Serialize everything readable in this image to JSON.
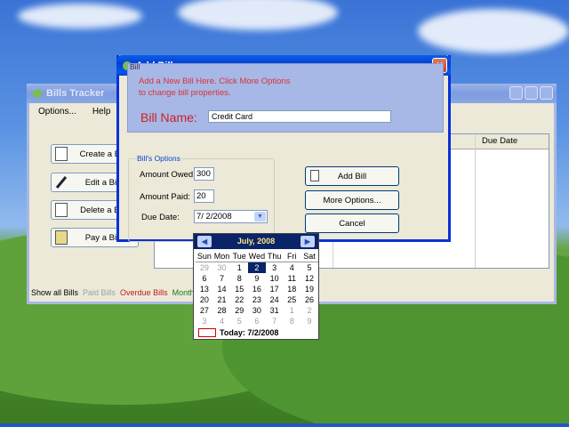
{
  "main_window": {
    "title": "Bills Tracker",
    "menu": [
      "Options...",
      "Help"
    ],
    "side_buttons": [
      "Create a Bill",
      "Edit a Bill",
      "Delete a Bill",
      "Pay a Bill"
    ],
    "grid_header_due": "Due Date",
    "status_tabs": [
      {
        "label": "Show all Bills",
        "color": "#000000"
      },
      {
        "label": "Paid Bills",
        "color": "#9aa0a6"
      },
      {
        "label": "Overdue Bills",
        "color": "#c21a1a"
      },
      {
        "label": "Monthly B",
        "color": "#1a7a1a"
      }
    ]
  },
  "dialog": {
    "title": "Add Bill",
    "bill_group_title": "Bill",
    "description_line1": "Add a New Bill Here. Click More Options",
    "description_line2": "to change bill properties.",
    "bill_name_label": "Bill Name:",
    "bill_name_value": "Credit Card",
    "options_group_title": "Bill's Options",
    "amount_owed_label": "Amount Owed:",
    "amount_owed_value": "300",
    "amount_paid_label": "Amount Paid:",
    "amount_paid_value": "20",
    "due_date_label": "Due Date:",
    "due_date_value": "7/  2/2008",
    "buttons": {
      "add": "Add Bill",
      "more": "More Options...",
      "cancel": "Cancel"
    }
  },
  "calendar": {
    "month_title": "July, 2008",
    "days_of_week": [
      "Sun",
      "Mon",
      "Tue",
      "Wed",
      "Thu",
      "Fri",
      "Sat"
    ],
    "weeks": [
      [
        "29",
        "30",
        "1",
        "2",
        "3",
        "4",
        "5"
      ],
      [
        "6",
        "7",
        "8",
        "9",
        "10",
        "11",
        "12"
      ],
      [
        "13",
        "14",
        "15",
        "16",
        "17",
        "18",
        "19"
      ],
      [
        "20",
        "21",
        "22",
        "23",
        "24",
        "25",
        "26"
      ],
      [
        "27",
        "28",
        "29",
        "30",
        "31",
        "1",
        "2"
      ],
      [
        "3",
        "4",
        "5",
        "6",
        "7",
        "8",
        "9"
      ]
    ],
    "selected_day": "2",
    "today_text": "Today: 7/2/2008",
    "colors": {
      "header": "#0a246a",
      "title": "#ffe880",
      "selected": "#0a246a",
      "other_month": "#a0a0a0"
    }
  }
}
